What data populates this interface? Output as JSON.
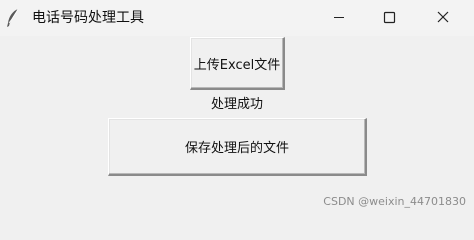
{
  "window": {
    "title": "电话号码处理工具",
    "icon": "feather-icon",
    "controls": {
      "minimize": "minimize-icon",
      "maximize": "maximize-icon",
      "close": "close-icon"
    }
  },
  "main": {
    "upload_button_label": "上传Excel文件",
    "status_text": "处理成功",
    "save_button_label": "保存处理后的文件"
  },
  "watermark": "CSDN @weixin_44701830",
  "colors": {
    "background": "#f0f0f0",
    "titlebar": "#f3f3f3",
    "button_face": "#f0f0f0",
    "button_shadow": "#8a8a8a",
    "watermark": "#8c8c8c"
  }
}
